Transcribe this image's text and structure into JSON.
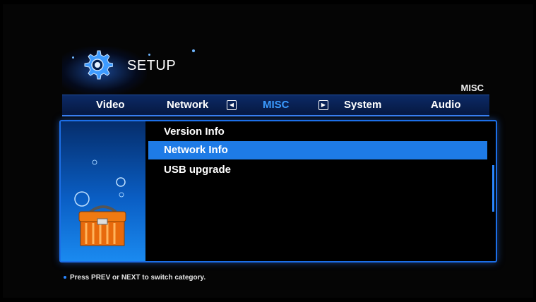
{
  "header": {
    "title": "SETUP",
    "current_category": "MISC"
  },
  "tabs": [
    {
      "label": "Video"
    },
    {
      "label": "Network"
    },
    {
      "label": "MISC",
      "active": true
    },
    {
      "label": "System"
    },
    {
      "label": "Audio"
    }
  ],
  "menu": {
    "items": [
      {
        "label": "Version Info"
      },
      {
        "label": "Network Info",
        "selected": true
      },
      {
        "label": "USB upgrade"
      }
    ]
  },
  "footer": {
    "hint": "Press PREV or NEXT to switch category."
  },
  "colors": {
    "accent": "#1e7be6",
    "active_tab": "#3b9bff",
    "background": "#000000"
  },
  "icons": {
    "logo": "gear-icon",
    "prev": "prev-arrow-icon",
    "next": "next-arrow-icon",
    "art": "toolbox-icon"
  }
}
